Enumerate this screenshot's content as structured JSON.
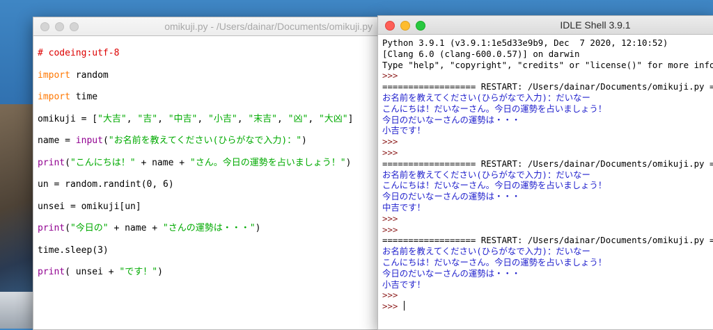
{
  "editor": {
    "title": "omikuji.py - /Users/dainar/Documents/omikuji.py",
    "lines": [
      [
        {
          "t": "# codeing:utf-8",
          "c": "comment"
        }
      ],
      [
        {
          "t": "import",
          "c": "kw"
        },
        {
          "t": " random",
          "c": ""
        }
      ],
      [
        {
          "t": "import",
          "c": "kw"
        },
        {
          "t": " time",
          "c": ""
        }
      ],
      [
        {
          "t": "omikuji = [",
          "c": ""
        },
        {
          "t": "\"大吉\"",
          "c": "str"
        },
        {
          "t": ", ",
          "c": ""
        },
        {
          "t": "\"吉\"",
          "c": "str"
        },
        {
          "t": ", ",
          "c": ""
        },
        {
          "t": "\"中吉\"",
          "c": "str"
        },
        {
          "t": ", ",
          "c": ""
        },
        {
          "t": "\"小吉\"",
          "c": "str"
        },
        {
          "t": ", ",
          "c": ""
        },
        {
          "t": "\"末吉\"",
          "c": "str"
        },
        {
          "t": ", ",
          "c": ""
        },
        {
          "t": "\"凶\"",
          "c": "str"
        },
        {
          "t": ", ",
          "c": ""
        },
        {
          "t": "\"大凶\"",
          "c": "str"
        },
        {
          "t": "]",
          "c": ""
        }
      ],
      [
        {
          "t": "name = ",
          "c": ""
        },
        {
          "t": "input",
          "c": "builtin"
        },
        {
          "t": "(",
          "c": ""
        },
        {
          "t": "\"お名前を教えてください(ひらがなで入力)：\"",
          "c": "str"
        },
        {
          "t": ")",
          "c": ""
        }
      ],
      [
        {
          "t": "print",
          "c": "builtin"
        },
        {
          "t": "(",
          "c": ""
        },
        {
          "t": "\"こんにちは！\"",
          "c": "str"
        },
        {
          "t": " + name + ",
          "c": ""
        },
        {
          "t": "\"さん。今日の運勢を占いましょう！\"",
          "c": "str"
        },
        {
          "t": ")",
          "c": ""
        }
      ],
      [
        {
          "t": "un = random.randint(0, 6)",
          "c": ""
        }
      ],
      [
        {
          "t": "unsei = omikuji[un]",
          "c": ""
        }
      ],
      [
        {
          "t": "print",
          "c": "builtin"
        },
        {
          "t": "(",
          "c": ""
        },
        {
          "t": "\"今日の\"",
          "c": "str"
        },
        {
          "t": " + name + ",
          "c": ""
        },
        {
          "t": "\"さんの運勢は・・・\"",
          "c": "str"
        },
        {
          "t": ")",
          "c": ""
        }
      ],
      [
        {
          "t": "time.sleep(3)",
          "c": ""
        }
      ],
      [
        {
          "t": "print",
          "c": "builtin"
        },
        {
          "t": "( unsei + ",
          "c": ""
        },
        {
          "t": "\"です！\"",
          "c": "str"
        },
        {
          "t": ")",
          "c": ""
        }
      ]
    ]
  },
  "shell": {
    "title": "IDLE Shell 3.9.1",
    "lines": [
      {
        "t": "Python 3.9.1 (v3.9.1:1e5d33e9b9, Dec  7 2020, 12:10:52)",
        "c": ""
      },
      {
        "t": "[Clang 6.0 (clang-600.0.57)] on darwin",
        "c": ""
      },
      {
        "t": "Type \"help\", \"copyright\", \"credits\" or \"license()\" for more information.",
        "c": ""
      },
      {
        "t": ">>> ",
        "c": "prompt"
      },
      {
        "t": "================== RESTART: /Users/dainar/Documents/omikuji.py ==================",
        "c": "restart"
      },
      {
        "t": "お名前を教えてください(ひらがなで入力)：だいなー",
        "c": "out"
      },
      {
        "t": "こんにちは！だいなーさん。今日の運勢を占いましょう！",
        "c": "out"
      },
      {
        "t": "今日のだいなーさんの運勢は・・・",
        "c": "out"
      },
      {
        "t": "小吉です！",
        "c": "out"
      },
      {
        "t": ">>> ",
        "c": "prompt"
      },
      {
        "t": ">>> ",
        "c": "prompt"
      },
      {
        "t": "================== RESTART: /Users/dainar/Documents/omikuji.py ==================",
        "c": "restart"
      },
      {
        "t": "お名前を教えてください(ひらがなで入力)：だいなー",
        "c": "out"
      },
      {
        "t": "こんにちは！だいなーさん。今日の運勢を占いましょう！",
        "c": "out"
      },
      {
        "t": "今日のだいなーさんの運勢は・・・",
        "c": "out"
      },
      {
        "t": "中吉です！",
        "c": "out"
      },
      {
        "t": ">>> ",
        "c": "prompt"
      },
      {
        "t": ">>> ",
        "c": "prompt"
      },
      {
        "t": "================== RESTART: /Users/dainar/Documents/omikuji.py ==================",
        "c": "restart"
      },
      {
        "t": "お名前を教えてください(ひらがなで入力)：だいなー",
        "c": "out"
      },
      {
        "t": "こんにちは！だいなーさん。今日の運勢を占いましょう！",
        "c": "out"
      },
      {
        "t": "今日のだいなーさんの運勢は・・・",
        "c": "out"
      },
      {
        "t": "小吉です！",
        "c": "out"
      },
      {
        "t": ">>> ",
        "c": "prompt"
      },
      {
        "t": ">>> ",
        "c": "prompt"
      }
    ]
  },
  "colors": {
    "comment": "#dd0000",
    "keyword": "#ff7700",
    "builtin": "#900090",
    "string": "#00aa00",
    "shell_output": "#1e1ecc",
    "shell_prompt": "#8b1a1a"
  }
}
